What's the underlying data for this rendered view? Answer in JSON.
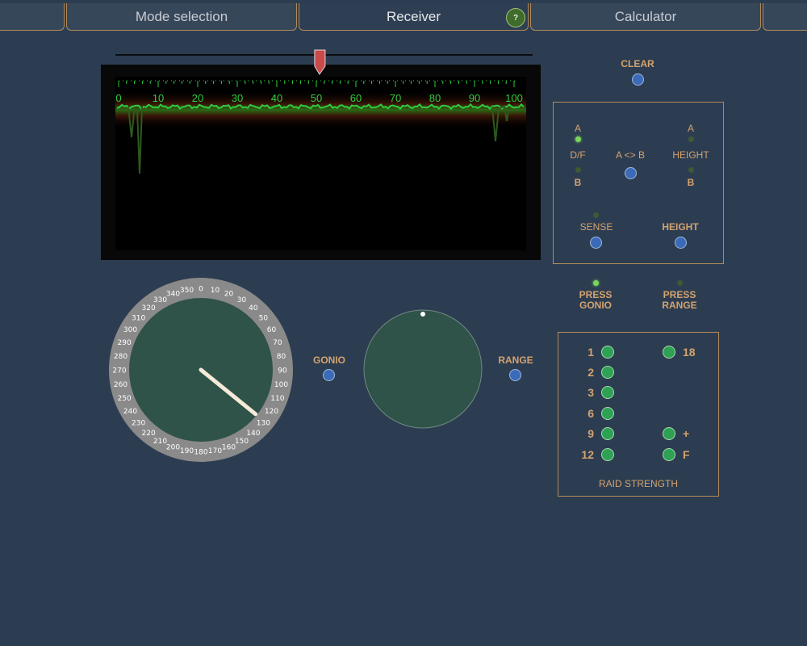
{
  "tabs": [
    {
      "label": ""
    },
    {
      "label": "Mode selection"
    },
    {
      "label": "Receiver",
      "active": true
    },
    {
      "label": "Calculator"
    },
    {
      "label": ""
    }
  ],
  "help_label": "?",
  "scope": {
    "scale_labels": [
      "0",
      "10",
      "20",
      "30",
      "40",
      "50",
      "60",
      "70",
      "80",
      "90",
      "100"
    ],
    "marker_value": 51,
    "trace_color": "#2ecc40"
  },
  "clear": {
    "label": "CLEAR"
  },
  "df_panel": {
    "a_left": "A",
    "df": "D/F",
    "b_left": "B",
    "swap": "A <> B",
    "a_right": "A",
    "height": "HEIGHT",
    "b_right": "B",
    "sense": "SENSE",
    "height_btn": "HEIGHT"
  },
  "gonio": {
    "label": "GONIO",
    "dial_labels": [
      "0",
      "10",
      "20",
      "30",
      "40",
      "50",
      "60",
      "70",
      "80",
      "90",
      "100",
      "110",
      "120",
      "130",
      "140",
      "150",
      "160",
      "170",
      "180",
      "190",
      "200",
      "210",
      "220",
      "230",
      "240",
      "250",
      "260",
      "270",
      "280",
      "290",
      "300",
      "310",
      "320",
      "330",
      "340",
      "350"
    ],
    "bearing": 129
  },
  "range": {
    "label": "RANGE"
  },
  "press_gonio": "PRESS\nGONIO",
  "press_range": "PRESS\nRANGE",
  "raid": {
    "left": [
      "1",
      "2",
      "3",
      "6",
      "9",
      "12"
    ],
    "right": [
      "18",
      "+",
      "F"
    ],
    "title": "RAID STRENGTH"
  }
}
